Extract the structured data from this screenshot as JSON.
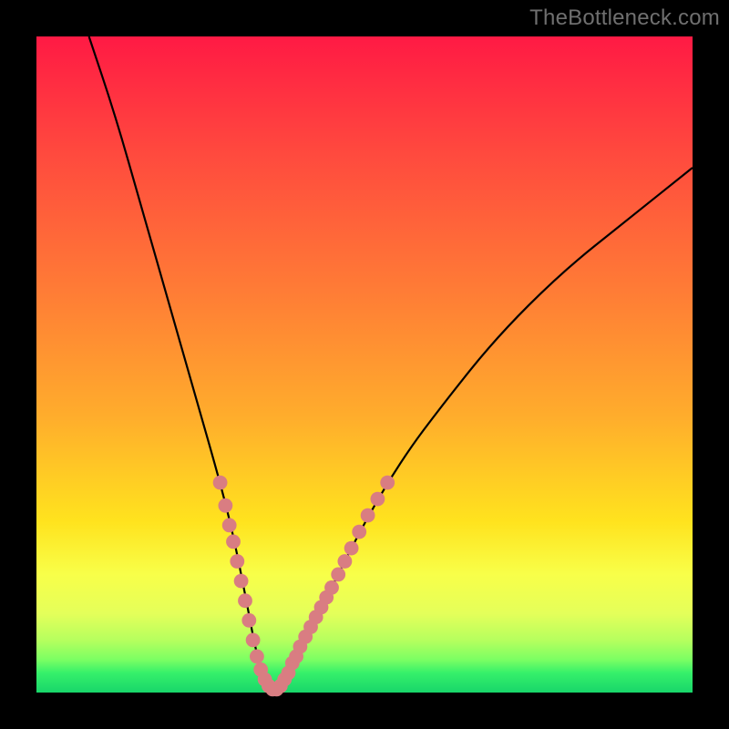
{
  "watermark": "TheBottleneck.com",
  "gradient_colors": [
    "#ff1a44",
    "#ff4a3e",
    "#ff7a36",
    "#ffad2c",
    "#ffe31e",
    "#f8ff49",
    "#e4ff5a",
    "#b6ff5e",
    "#7bff63",
    "#36f06a",
    "#18d66a"
  ],
  "chart_data": {
    "type": "line",
    "title": "",
    "xlabel": "",
    "ylabel": "",
    "xlim": [
      0,
      100
    ],
    "ylim": [
      0,
      100
    ],
    "grid": false,
    "legend": false,
    "series": [
      {
        "name": "bottleneck-curve",
        "color": "#000000",
        "x": [
          8,
          12,
          16,
          20,
          24,
          28,
          30,
          32,
          33.5,
          35,
          36.5,
          38,
          40,
          44,
          50,
          56,
          62,
          70,
          80,
          90,
          100
        ],
        "y": [
          100,
          88,
          74,
          60,
          46,
          32,
          24,
          14,
          6,
          1,
          0.5,
          2,
          6,
          14,
          26,
          36,
          44,
          54,
          64,
          72,
          80
        ]
      }
    ],
    "markers": {
      "name": "highlight-points",
      "color": "#d97d82",
      "radius": 1.1,
      "points": [
        {
          "x": 28.0,
          "y": 32.0
        },
        {
          "x": 28.8,
          "y": 28.5
        },
        {
          "x": 29.4,
          "y": 25.5
        },
        {
          "x": 30.0,
          "y": 23.0
        },
        {
          "x": 30.6,
          "y": 20.0
        },
        {
          "x": 31.2,
          "y": 17.0
        },
        {
          "x": 31.8,
          "y": 14.0
        },
        {
          "x": 32.4,
          "y": 11.0
        },
        {
          "x": 33.0,
          "y": 8.0
        },
        {
          "x": 33.6,
          "y": 5.5
        },
        {
          "x": 34.2,
          "y": 3.5
        },
        {
          "x": 34.8,
          "y": 2.0
        },
        {
          "x": 35.4,
          "y": 1.0
        },
        {
          "x": 36.0,
          "y": 0.5
        },
        {
          "x": 36.6,
          "y": 0.5
        },
        {
          "x": 37.2,
          "y": 1.0
        },
        {
          "x": 37.8,
          "y": 2.0
        },
        {
          "x": 38.4,
          "y": 3.0
        },
        {
          "x": 39.0,
          "y": 4.5
        },
        {
          "x": 39.6,
          "y": 5.5
        },
        {
          "x": 40.2,
          "y": 7.0
        },
        {
          "x": 41.0,
          "y": 8.5
        },
        {
          "x": 41.8,
          "y": 10.0
        },
        {
          "x": 42.6,
          "y": 11.5
        },
        {
          "x": 43.4,
          "y": 13.0
        },
        {
          "x": 44.2,
          "y": 14.5
        },
        {
          "x": 45.0,
          "y": 16.0
        },
        {
          "x": 46.0,
          "y": 18.0
        },
        {
          "x": 47.0,
          "y": 20.0
        },
        {
          "x": 48.0,
          "y": 22.0
        },
        {
          "x": 49.2,
          "y": 24.5
        },
        {
          "x": 50.5,
          "y": 27.0
        },
        {
          "x": 52.0,
          "y": 29.5
        },
        {
          "x": 53.5,
          "y": 32.0
        }
      ]
    },
    "annotations": []
  }
}
